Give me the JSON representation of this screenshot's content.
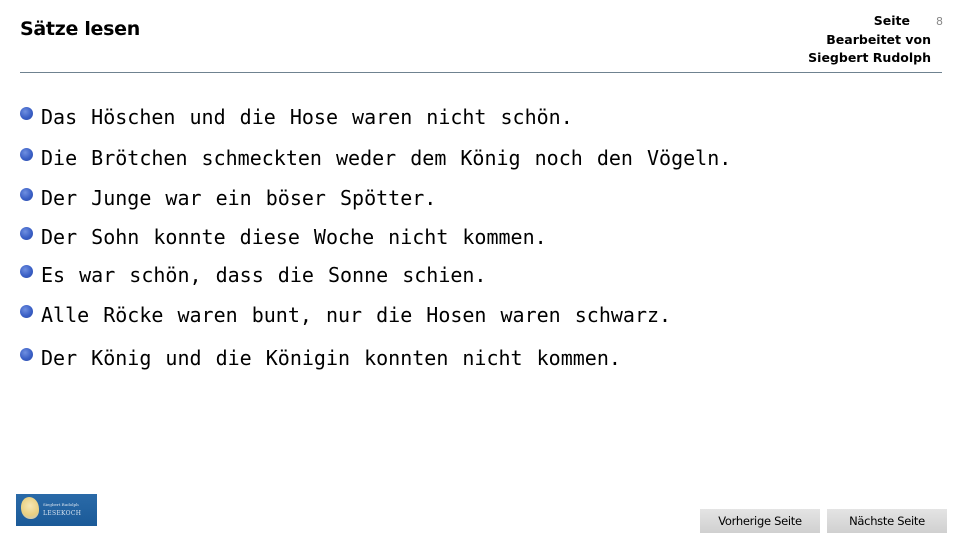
{
  "header": {
    "title": "Sätze lesen",
    "page_label": "Seite",
    "page_number": "8",
    "edited_by_label": "Bearbeitet von",
    "author": "Siegbert Rudolph"
  },
  "sentences": [
    "Das Höschen und die Hose waren nicht schön.",
    "Die Brötchen schmeckten weder dem König noch den Vögeln.",
    "Der Junge war ein böser Spötter.",
    "Der Sohn konnte diese Woche nicht kommen.",
    "Es war schön, dass die Sonne schien.",
    "Alle Röcke waren bunt, nur die Hosen waren schwarz.",
    "Der König und die Königin konnten nicht kommen."
  ],
  "logo": {
    "line1": "Siegbert Rudolph",
    "line2": "LESEKOCH"
  },
  "navigation": {
    "prev_label": "Vorherige Seite",
    "next_label": "Nächste Seite"
  },
  "colors": {
    "bullet": "#3a5fc5",
    "divider": "#6f8290",
    "logo_bg": "#1b5a98",
    "button_bg": "#d9d9d9"
  }
}
